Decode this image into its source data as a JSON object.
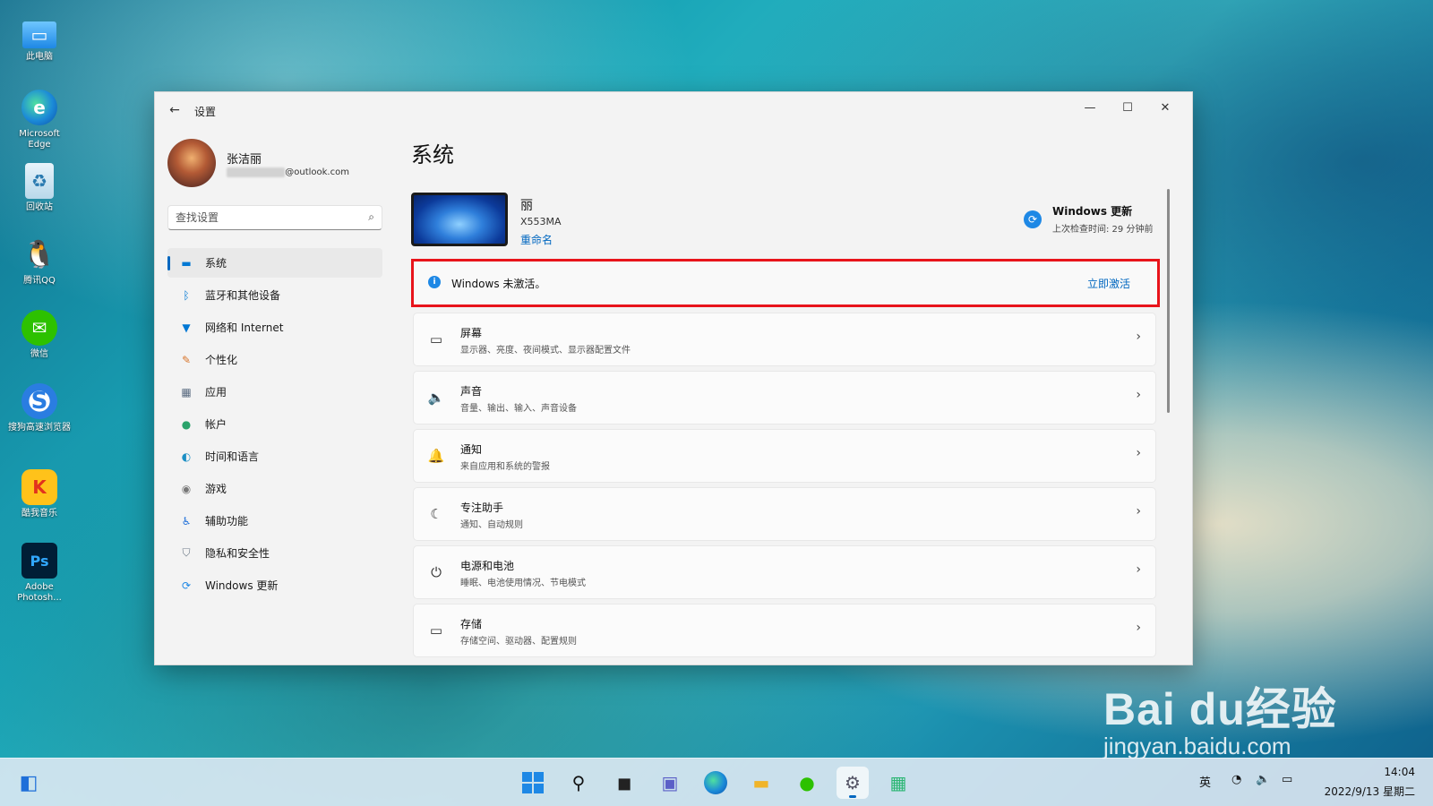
{
  "desktop": {
    "icons": [
      {
        "label": "此电脑",
        "icon": "computer-icon"
      },
      {
        "label": "Microsoft Edge",
        "icon": "edge-icon"
      },
      {
        "label": "回收站",
        "icon": "recycle-bin-icon"
      },
      {
        "label": "腾讯QQ",
        "icon": "qq-icon"
      },
      {
        "label": "微信",
        "icon": "wechat-icon"
      },
      {
        "label": "搜狗高速浏览器",
        "icon": "sogou-browser-icon"
      },
      {
        "label": "酷我音乐",
        "icon": "kuwo-music-icon"
      },
      {
        "label": "Adobe Photosh...",
        "icon": "photoshop-icon"
      }
    ]
  },
  "window": {
    "title": "设置",
    "controls": {
      "minimize": "—",
      "maximize": "☐",
      "close": "✕"
    }
  },
  "user": {
    "name": "张洁丽",
    "email_hidden": "weishengxxx",
    "email_domain": "@outlook.com"
  },
  "search": {
    "placeholder": "查找设置"
  },
  "sidebar": {
    "items": [
      {
        "label": "系统",
        "icon": "system-icon",
        "active": true
      },
      {
        "label": "蓝牙和其他设备",
        "icon": "bluetooth-icon"
      },
      {
        "label": "网络和 Internet",
        "icon": "wifi-icon"
      },
      {
        "label": "个性化",
        "icon": "pen-icon"
      },
      {
        "label": "应用",
        "icon": "apps-icon"
      },
      {
        "label": "帐户",
        "icon": "account-icon"
      },
      {
        "label": "时间和语言",
        "icon": "globe-icon"
      },
      {
        "label": "游戏",
        "icon": "gamepad-icon"
      },
      {
        "label": "辅助功能",
        "icon": "accessibility-icon"
      },
      {
        "label": "隐私和安全性",
        "icon": "shield-icon"
      },
      {
        "label": "Windows 更新",
        "icon": "update-icon"
      }
    ]
  },
  "main": {
    "title": "系统",
    "device": {
      "name": "丽",
      "model": "X553MA",
      "rename": "重命名"
    },
    "update": {
      "title": "Windows 更新",
      "subtitle": "上次检查时间: 29 分钟前"
    },
    "activation": {
      "text": "Windows 未激活。",
      "link": "立即激活"
    },
    "cards": [
      {
        "title": "屏幕",
        "subtitle": "显示器、亮度、夜间模式、显示器配置文件",
        "icon": "monitor-icon"
      },
      {
        "title": "声音",
        "subtitle": "音量、输出、输入、声音设备",
        "icon": "speaker-icon"
      },
      {
        "title": "通知",
        "subtitle": "来自应用和系统的警报",
        "icon": "bell-icon"
      },
      {
        "title": "专注助手",
        "subtitle": "通知、自动规则",
        "icon": "moon-icon"
      },
      {
        "title": "电源和电池",
        "subtitle": "睡眠、电池使用情况、节电模式",
        "icon": "power-icon"
      },
      {
        "title": "存储",
        "subtitle": "存储空间、驱动器、配置规则",
        "icon": "storage-icon"
      }
    ]
  },
  "watermark": {
    "main": "Bai du经验",
    "sub": "jingyan.baidu.com"
  },
  "taskbar": {
    "tray": {
      "ime": "英"
    },
    "clock": {
      "time": "14:04",
      "date": "2022/9/13 星期二"
    }
  },
  "colors": {
    "accent": "#0067c0",
    "highlight_border": "#e8141b"
  }
}
